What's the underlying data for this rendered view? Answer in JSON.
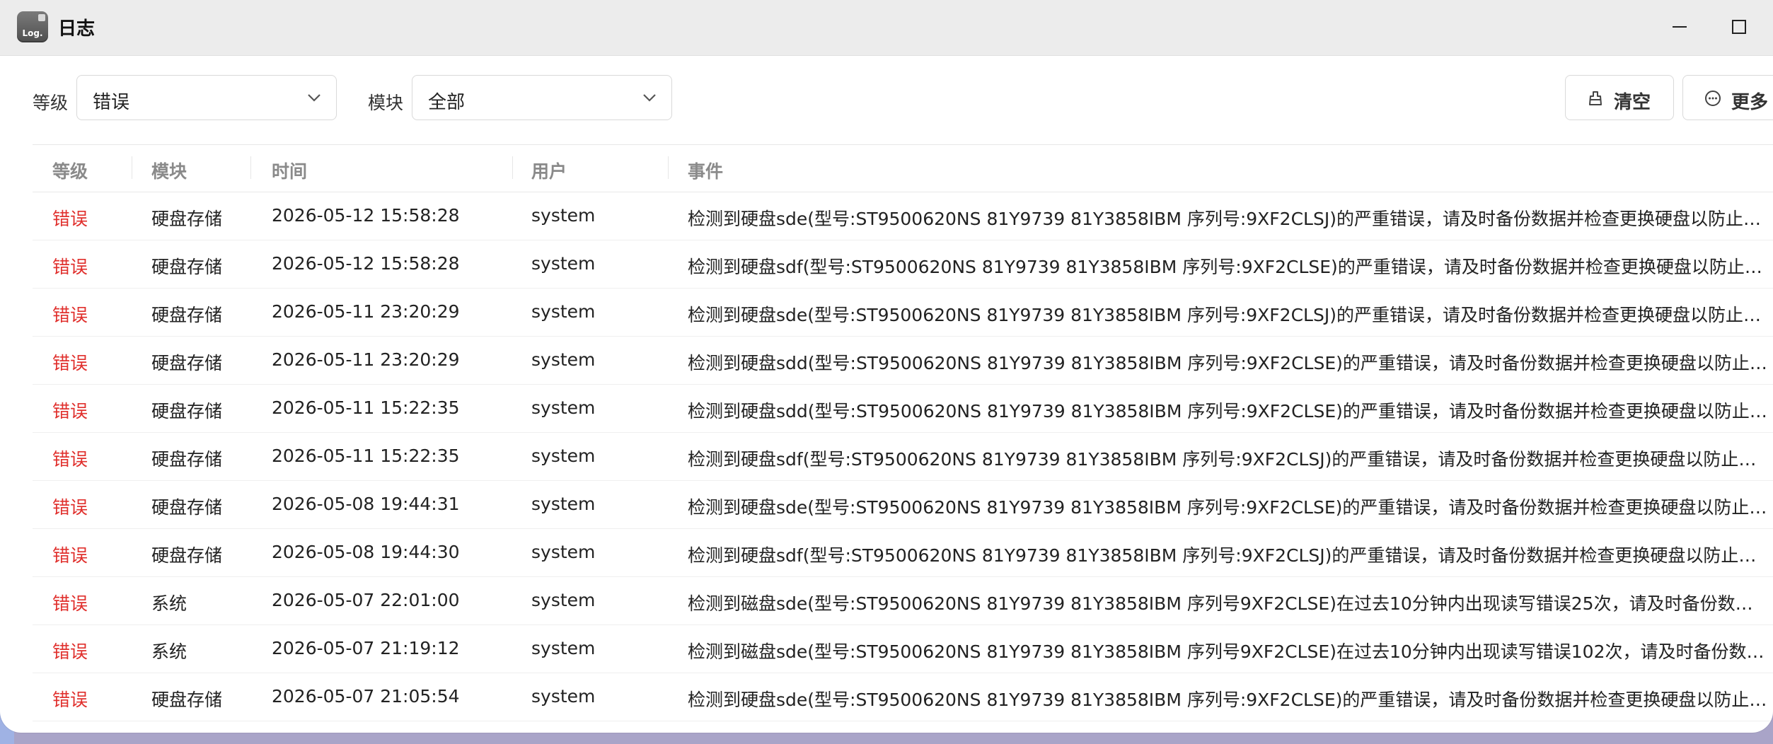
{
  "window": {
    "icon_text": "Log.",
    "title": "日志"
  },
  "filters": {
    "level_label": "等级",
    "level_value": "错误",
    "module_label": "模块",
    "module_value": "全部",
    "clear_label": "清空",
    "more_label": "更多"
  },
  "table": {
    "headers": {
      "level": "等级",
      "module": "模块",
      "time": "时间",
      "user": "用户",
      "event": "事件"
    },
    "rows": [
      {
        "level": "错误",
        "module": "硬盘存储",
        "time": "2026-05-12 15:58:28",
        "user": "system",
        "event": "检测到硬盘sde(型号:ST9500620NS 81Y9739 81Y3858IBM 序列号:9XF2CLSJ)的严重错误，请及时备份数据并检查更换硬盘以防止数据丢失"
      },
      {
        "level": "错误",
        "module": "硬盘存储",
        "time": "2026-05-12 15:58:28",
        "user": "system",
        "event": "检测到硬盘sdf(型号:ST9500620NS 81Y9739 81Y3858IBM 序列号:9XF2CLSE)的严重错误，请及时备份数据并检查更换硬盘以防止数据丢失"
      },
      {
        "level": "错误",
        "module": "硬盘存储",
        "time": "2026-05-11 23:20:29",
        "user": "system",
        "event": "检测到硬盘sde(型号:ST9500620NS 81Y9739 81Y3858IBM 序列号:9XF2CLSJ)的严重错误，请及时备份数据并检查更换硬盘以防止数据丢失"
      },
      {
        "level": "错误",
        "module": "硬盘存储",
        "time": "2026-05-11 23:20:29",
        "user": "system",
        "event": "检测到硬盘sdd(型号:ST9500620NS 81Y9739 81Y3858IBM 序列号:9XF2CLSE)的严重错误，请及时备份数据并检查更换硬盘以防止数据丢失"
      },
      {
        "level": "错误",
        "module": "硬盘存储",
        "time": "2026-05-11 15:22:35",
        "user": "system",
        "event": "检测到硬盘sdd(型号:ST9500620NS 81Y9739 81Y3858IBM 序列号:9XF2CLSE)的严重错误，请及时备份数据并检查更换硬盘以防止数据丢失"
      },
      {
        "level": "错误",
        "module": "硬盘存储",
        "time": "2026-05-11 15:22:35",
        "user": "system",
        "event": "检测到硬盘sdf(型号:ST9500620NS 81Y9739 81Y3858IBM 序列号:9XF2CLSJ)的严重错误，请及时备份数据并检查更换硬盘以防止数据丢失"
      },
      {
        "level": "错误",
        "module": "硬盘存储",
        "time": "2026-05-08 19:44:31",
        "user": "system",
        "event": "检测到硬盘sde(型号:ST9500620NS 81Y9739 81Y3858IBM 序列号:9XF2CLSE)的严重错误，请及时备份数据并检查更换硬盘以防止数据丢失"
      },
      {
        "level": "错误",
        "module": "硬盘存储",
        "time": "2026-05-08 19:44:30",
        "user": "system",
        "event": "检测到硬盘sdf(型号:ST9500620NS 81Y9739 81Y3858IBM 序列号:9XF2CLSJ)的严重错误，请及时备份数据并检查更换硬盘以防止数据丢失"
      },
      {
        "level": "错误",
        "module": "系统",
        "time": "2026-05-07 22:01:00",
        "user": "system",
        "event": "检测到磁盘sde(型号:ST9500620NS 81Y9739 81Y3858IBM 序列号9XF2CLSE)在过去10分钟内出现读写错误25次，请及时备份数据并检查硬盘"
      },
      {
        "level": "错误",
        "module": "系统",
        "time": "2026-05-07 21:19:12",
        "user": "system",
        "event": "检测到磁盘sde(型号:ST9500620NS 81Y9739 81Y3858IBM 序列号9XF2CLSE)在过去10分钟内出现读写错误102次，请及时备份数据并检查硬盘"
      },
      {
        "level": "错误",
        "module": "硬盘存储",
        "time": "2026-05-07 21:05:54",
        "user": "system",
        "event": "检测到硬盘sde(型号:ST9500620NS 81Y9739 81Y3858IBM 序列号:9XF2CLSE)的严重错误，请及时备份数据并检查更换硬盘以防止数据丢失"
      }
    ]
  },
  "colors": {
    "error": "#e0302d",
    "header_text": "#8a8a8a"
  }
}
